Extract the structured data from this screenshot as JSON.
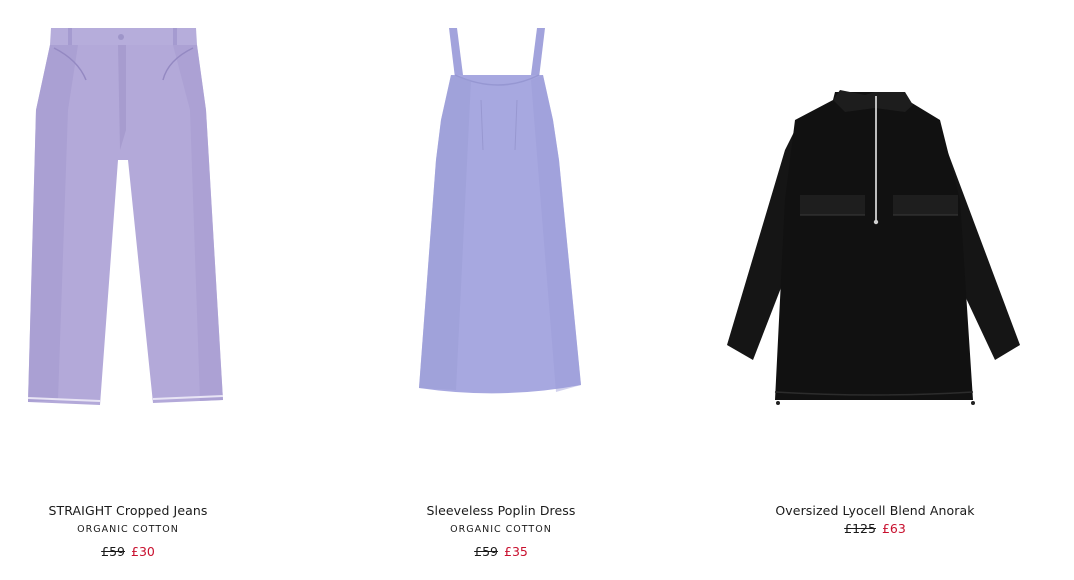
{
  "products": [
    {
      "name": "STRAIGHT Cropped Jeans",
      "material": "ORGANIC COTTON",
      "old_price": "£59",
      "sale_price": "£30",
      "color": "#b3a9d9"
    },
    {
      "name": "Sleeveless Poplin Dress",
      "material": "ORGANIC COTTON",
      "old_price": "£59",
      "sale_price": "£35",
      "color": "#a7a8e0"
    },
    {
      "name": "Oversized Lyocell Blend Anorak",
      "old_price": "£125",
      "sale_price": "£63",
      "color": "#111111"
    }
  ],
  "colors": {
    "sale": "#c8102e",
    "text": "#1a1a1a"
  }
}
